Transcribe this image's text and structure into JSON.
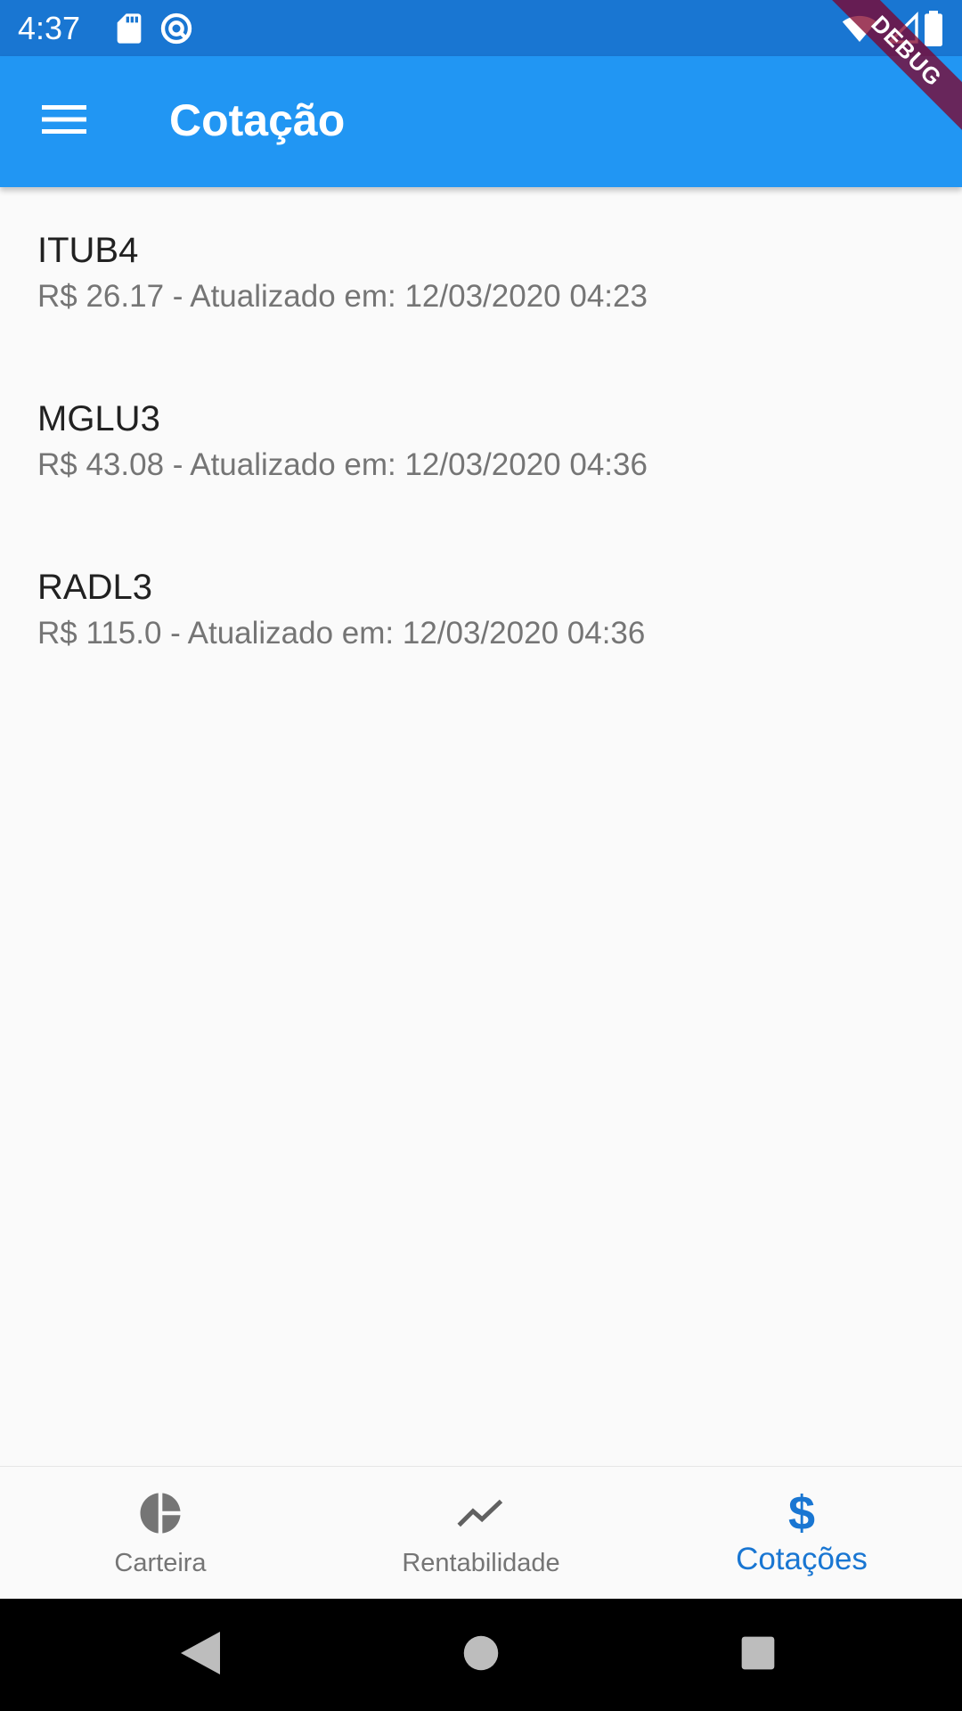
{
  "status_bar": {
    "time": "4:37",
    "icons": [
      "sd-card-icon",
      "sync-icon",
      "wifi-icon",
      "signal-icon",
      "battery-icon"
    ]
  },
  "debug_banner": {
    "label": "DEBUG"
  },
  "app_bar": {
    "title": "Cotação",
    "menu_icon": "menu-icon"
  },
  "quotes": [
    {
      "symbol": "ITUB4",
      "detail": "R$ 26.17 - Atualizado em: 12/03/2020 04:23"
    },
    {
      "symbol": "MGLU3",
      "detail": "R$ 43.08 - Atualizado em: 12/03/2020 04:36"
    },
    {
      "symbol": "RADL3",
      "detail": "R$ 115.0 - Atualizado em: 12/03/2020 04:36"
    }
  ],
  "bottom_nav": {
    "items": [
      {
        "label": "Carteira",
        "icon": "pie-chart-icon",
        "active": false
      },
      {
        "label": "Rentabilidade",
        "icon": "trending-icon",
        "active": false
      },
      {
        "label": "Cotações",
        "icon": "dollar-icon",
        "active": true
      }
    ]
  },
  "system_nav": {
    "icons": [
      "back-icon",
      "home-icon",
      "recents-icon"
    ]
  },
  "colors": {
    "status_bar": "#1976d2",
    "app_bar": "#2196f3",
    "active_nav": "#1976d2",
    "inactive_nav": "#757575",
    "background": "#fafafa"
  }
}
